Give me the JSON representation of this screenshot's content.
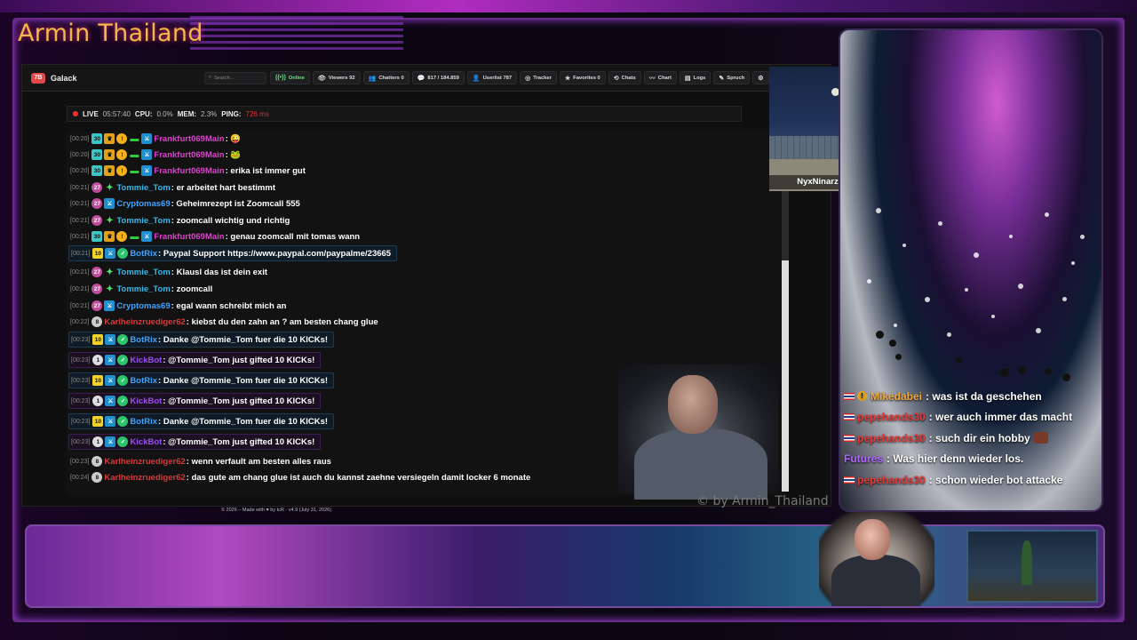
{
  "overlay": {
    "title": "Armin Thailand",
    "watermark": "© by Armin_Thailand"
  },
  "navbar": {
    "brand_logo": "7B",
    "channel": "Galack",
    "search_placeholder": "Search...",
    "buttons": [
      {
        "label": "Online",
        "icon": "signal-icon"
      },
      {
        "label": "Viewers 92",
        "icon": "eye-icon"
      },
      {
        "label": "Chatters 0",
        "icon": "users-icon"
      },
      {
        "label": "817 / 184.859",
        "icon": "chat-icon"
      },
      {
        "label": "Userlist 787",
        "icon": "user-icon"
      },
      {
        "label": "Tracker",
        "icon": "tracker-icon"
      },
      {
        "label": "Favorites 0",
        "icon": "star-icon"
      },
      {
        "label": "Chats",
        "icon": "history-icon"
      },
      {
        "label": "Chart",
        "icon": "chart-icon"
      },
      {
        "label": "Logs",
        "icon": "logs-icon"
      },
      {
        "label": "Spruch",
        "icon": "quote-icon"
      }
    ]
  },
  "status": {
    "live": "LIVE",
    "time": "05:57:40",
    "cpu_label": "CPU:",
    "cpu": "0.0%",
    "mem_label": "MEM:",
    "mem": "2.3%",
    "ping_label": "PING:",
    "ping": "726 ms"
  },
  "chat": [
    {
      "ts": "[00:20]",
      "badges": [
        "sub",
        "crown",
        "coin",
        "gift",
        "sword"
      ],
      "user": "Frankfurt069Main",
      "ucls": "u-pink",
      "msg": ": 😜"
    },
    {
      "ts": "[00:20]",
      "badges": [
        "sub",
        "crown",
        "coin",
        "gift",
        "sword"
      ],
      "user": "Frankfurt069Main",
      "ucls": "u-pink",
      "msg": ": 🐸"
    },
    {
      "ts": "[00:20]",
      "badges": [
        "sub",
        "crown",
        "coin",
        "gift",
        "sword"
      ],
      "user": "Frankfurt069Main",
      "ucls": "u-pink",
      "msg": ": erika ist immer gut"
    },
    {
      "ts": "[00:21]",
      "badges": [
        "pink",
        "star"
      ],
      "user": "Tommie_Tom",
      "ucls": "u-cyan",
      "msg": ": er arbeitet hart bestimmt"
    },
    {
      "ts": "[00:21]",
      "badges": [
        "pink",
        "sword"
      ],
      "user": "Cryptomas69",
      "ucls": "u-blue",
      "msg": ": Geheimrezept ist Zoomcall 555"
    },
    {
      "ts": "[00:21]",
      "badges": [
        "pink",
        "star"
      ],
      "user": "Tommie_Tom",
      "ucls": "u-cyan",
      "msg": ": zoomcall wichtig und richtig"
    },
    {
      "ts": "[00:21]",
      "badges": [
        "sub",
        "crown",
        "coin",
        "gift",
        "sword"
      ],
      "user": "Frankfurt069Main",
      "ucls": "u-pink",
      "msg": ": genau zoomcall mit tomas wann"
    },
    {
      "ts": "[00:21]",
      "badges": [
        "ten",
        "sword",
        "check"
      ],
      "user": "BotRix",
      "ucls": "u-blue",
      "msg": ": Paypal Support https://www.paypal.com/paypalme/23665",
      "hl": "bot"
    },
    {
      "ts": "[00:21]",
      "badges": [
        "pink",
        "star"
      ],
      "user": "Tommie_Tom",
      "ucls": "u-cyan",
      "msg": ": Klausl das ist dein exit"
    },
    {
      "ts": "[00:21]",
      "badges": [
        "pink",
        "star"
      ],
      "user": "Tommie_Tom",
      "ucls": "u-cyan",
      "msg": ": zoomcall"
    },
    {
      "ts": "[00:21]",
      "badges": [
        "pink",
        "sword"
      ],
      "user": "Cryptomas69",
      "ucls": "u-blue",
      "msg": ": egal wann schreibt mich an"
    },
    {
      "ts": "[00:22]",
      "badges": [
        "eight"
      ],
      "user": "Karlheinzruediger62",
      "ucls": "u-red",
      "msg": ": kiebst du den zahn an ? am besten chang glue"
    },
    {
      "ts": "[00:23]",
      "badges": [
        "ten",
        "sword",
        "check"
      ],
      "user": "BotRix",
      "ucls": "u-blue",
      "msg": ": Danke @Tommie_Tom fuer die 10 KICKs!",
      "hl": "bot"
    },
    {
      "ts": "[00:23]",
      "badges": [
        "one",
        "sword",
        "check"
      ],
      "user": "KickBot",
      "ucls": "u-purple",
      "msg": ": @Tommie_Tom just gifted 10 KICKs!",
      "hl": "kick"
    },
    {
      "ts": "[00:23]",
      "badges": [
        "ten",
        "sword",
        "check"
      ],
      "user": "BotRix",
      "ucls": "u-blue",
      "msg": ": Danke @Tommie_Tom fuer die 10 KICKs!",
      "hl": "bot"
    },
    {
      "ts": "[00:23]",
      "badges": [
        "one",
        "sword",
        "check"
      ],
      "user": "KickBot",
      "ucls": "u-purple",
      "msg": ": @Tommie_Tom just gifted 10 KICKs!",
      "hl": "kick"
    },
    {
      "ts": "[00:23]",
      "badges": [
        "ten",
        "sword",
        "check"
      ],
      "user": "BotRix",
      "ucls": "u-blue",
      "msg": ": Danke @Tommie_Tom fuer die 10 KICKs!",
      "hl": "bot"
    },
    {
      "ts": "[00:23]",
      "badges": [
        "one",
        "sword",
        "check"
      ],
      "user": "KickBot",
      "ucls": "u-purple",
      "msg": ": @Tommie_Tom just gifted 10 KICKs!",
      "hl": "kick"
    },
    {
      "ts": "[00:23]",
      "badges": [
        "eight"
      ],
      "user": "Karlheinzruediger62",
      "ucls": "u-red",
      "msg": ": wenn verfault am besten alles raus"
    },
    {
      "ts": "[00:24]",
      "badges": [
        "eight"
      ],
      "user": "Karlheinzruediger62",
      "ucls": "u-red",
      "msg": ": das gute am chang glue ist auch du kannst zaehne versiegeln damit locker 6 monate"
    }
  ],
  "footer": "© 2026 – Made with ♥ by tcR · v4.9 (July 31, 2026)",
  "video": {
    "caption": "NyxNinarz folgt dem Kanal!"
  },
  "side_chat": [
    {
      "flag": true,
      "coin": true,
      "user": "Mikedabei",
      "ucls": "sn-gold",
      "msg": ": was ist da geschehen"
    },
    {
      "flag": true,
      "coin": false,
      "user": "pepehands30",
      "ucls": "sn-red",
      "msg": ": wer auch immer das macht"
    },
    {
      "flag": true,
      "coin": false,
      "user": "pepehands30",
      "ucls": "sn-red",
      "msg": ": such dir ein hobby",
      "emote": true
    },
    {
      "flag": false,
      "coin": false,
      "user": "Futures",
      "ucls": "sn-purple",
      "msg": ": Was hier denn wieder los."
    },
    {
      "flag": true,
      "coin": false,
      "user": "pepehands30",
      "ucls": "sn-red",
      "msg": ": schon wieder bot attacke"
    }
  ]
}
